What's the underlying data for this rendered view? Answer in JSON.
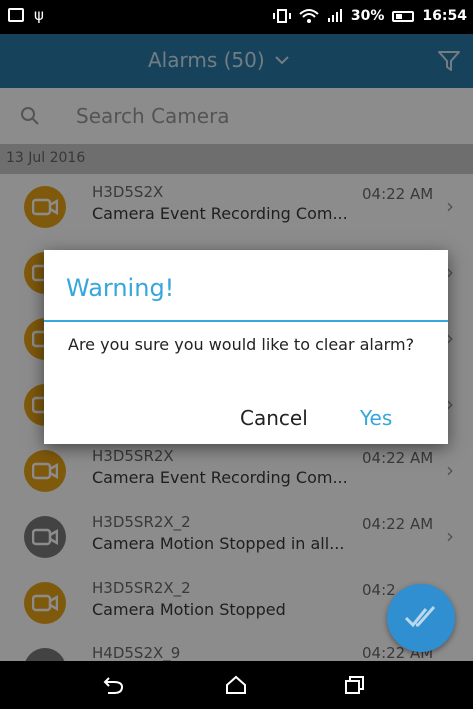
{
  "status_bar": {
    "battery": "30%",
    "time": "16:54"
  },
  "app_bar": {
    "title": "Alarms (50)",
    "dropdown_icon": "chevron-down-icon",
    "filter_icon": "filter-icon"
  },
  "search": {
    "placeholder": "Search Camera"
  },
  "list": {
    "date_header": "13 Jul 2016",
    "items": [
      {
        "name": "H3D5S2X",
        "event": "Camera Event Recording Com...",
        "time": "04:22 AM",
        "color": "#e8a317"
      },
      {
        "name": "",
        "event": "",
        "time": "",
        "color": "#e8a317"
      },
      {
        "name": "",
        "event": "",
        "time": "",
        "color": "#e8a317"
      },
      {
        "name": "",
        "event": "",
        "time": "",
        "color": "#e8a317"
      },
      {
        "name": "H3D5SR2X",
        "event": "Camera Event Recording Com...",
        "time": "04:22 AM",
        "color": "#e8a317"
      },
      {
        "name": "H3D5SR2X_2",
        "event": "Camera Motion Stopped in all...",
        "time": "04:22 AM",
        "color": "#7a7a7a"
      },
      {
        "name": "H3D5SR2X_2",
        "event": "Camera Motion Stopped",
        "time": "04:2",
        "color": "#e8a317"
      },
      {
        "name": "H4D5S2X_9",
        "event": "",
        "time": "04:22 AM",
        "color": "#7a7a7a"
      }
    ]
  },
  "dialog": {
    "title": "Warning!",
    "message": "Are you sure you would like to clear alarm?",
    "cancel_label": "Cancel",
    "confirm_label": "Yes"
  },
  "accent_color": "#35a7db",
  "app_bar_color": "#2a79a8"
}
